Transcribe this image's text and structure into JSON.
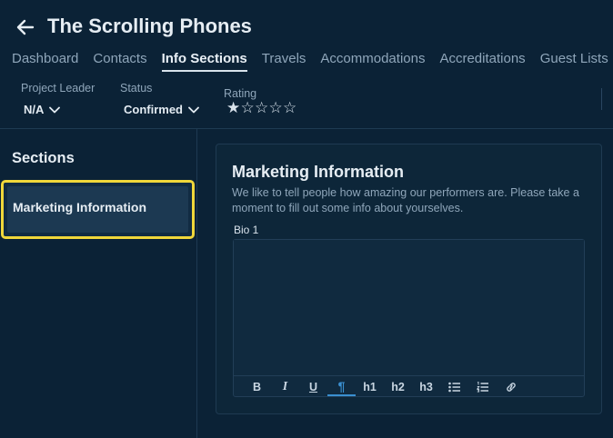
{
  "header": {
    "title": "The Scrolling Phones",
    "tabs": [
      {
        "label": "Dashboard"
      },
      {
        "label": "Contacts"
      },
      {
        "label": "Info Sections"
      },
      {
        "label": "Travels"
      },
      {
        "label": "Accommodations"
      },
      {
        "label": "Accreditations"
      },
      {
        "label": "Guest Lists"
      }
    ],
    "active_tab": "Info Sections"
  },
  "meta": {
    "project_leader_label": "Project Leader",
    "project_leader_value": "N/A",
    "status_label": "Status",
    "status_value": "Confirmed",
    "rating_label": "Rating",
    "rating": 1,
    "rating_max": 5
  },
  "sidebar": {
    "title": "Sections",
    "items": [
      {
        "label": "Marketing Information",
        "selected": true
      }
    ]
  },
  "section": {
    "title": "Marketing Information",
    "description": "We like to tell people how amazing our performers are. Please take a moment to fill out some info about yourselves.",
    "field_label": "Bio 1",
    "field_value": ""
  },
  "toolbar": {
    "bold": "B",
    "italic": "I",
    "underline": "U",
    "paragraph": "¶",
    "h1": "h1",
    "h2": "h2",
    "h3": "h3"
  },
  "colors": {
    "background": "#0b2236",
    "card": "#0d2639",
    "highlight": "#f0d73a",
    "accent": "#3a8fd0"
  }
}
